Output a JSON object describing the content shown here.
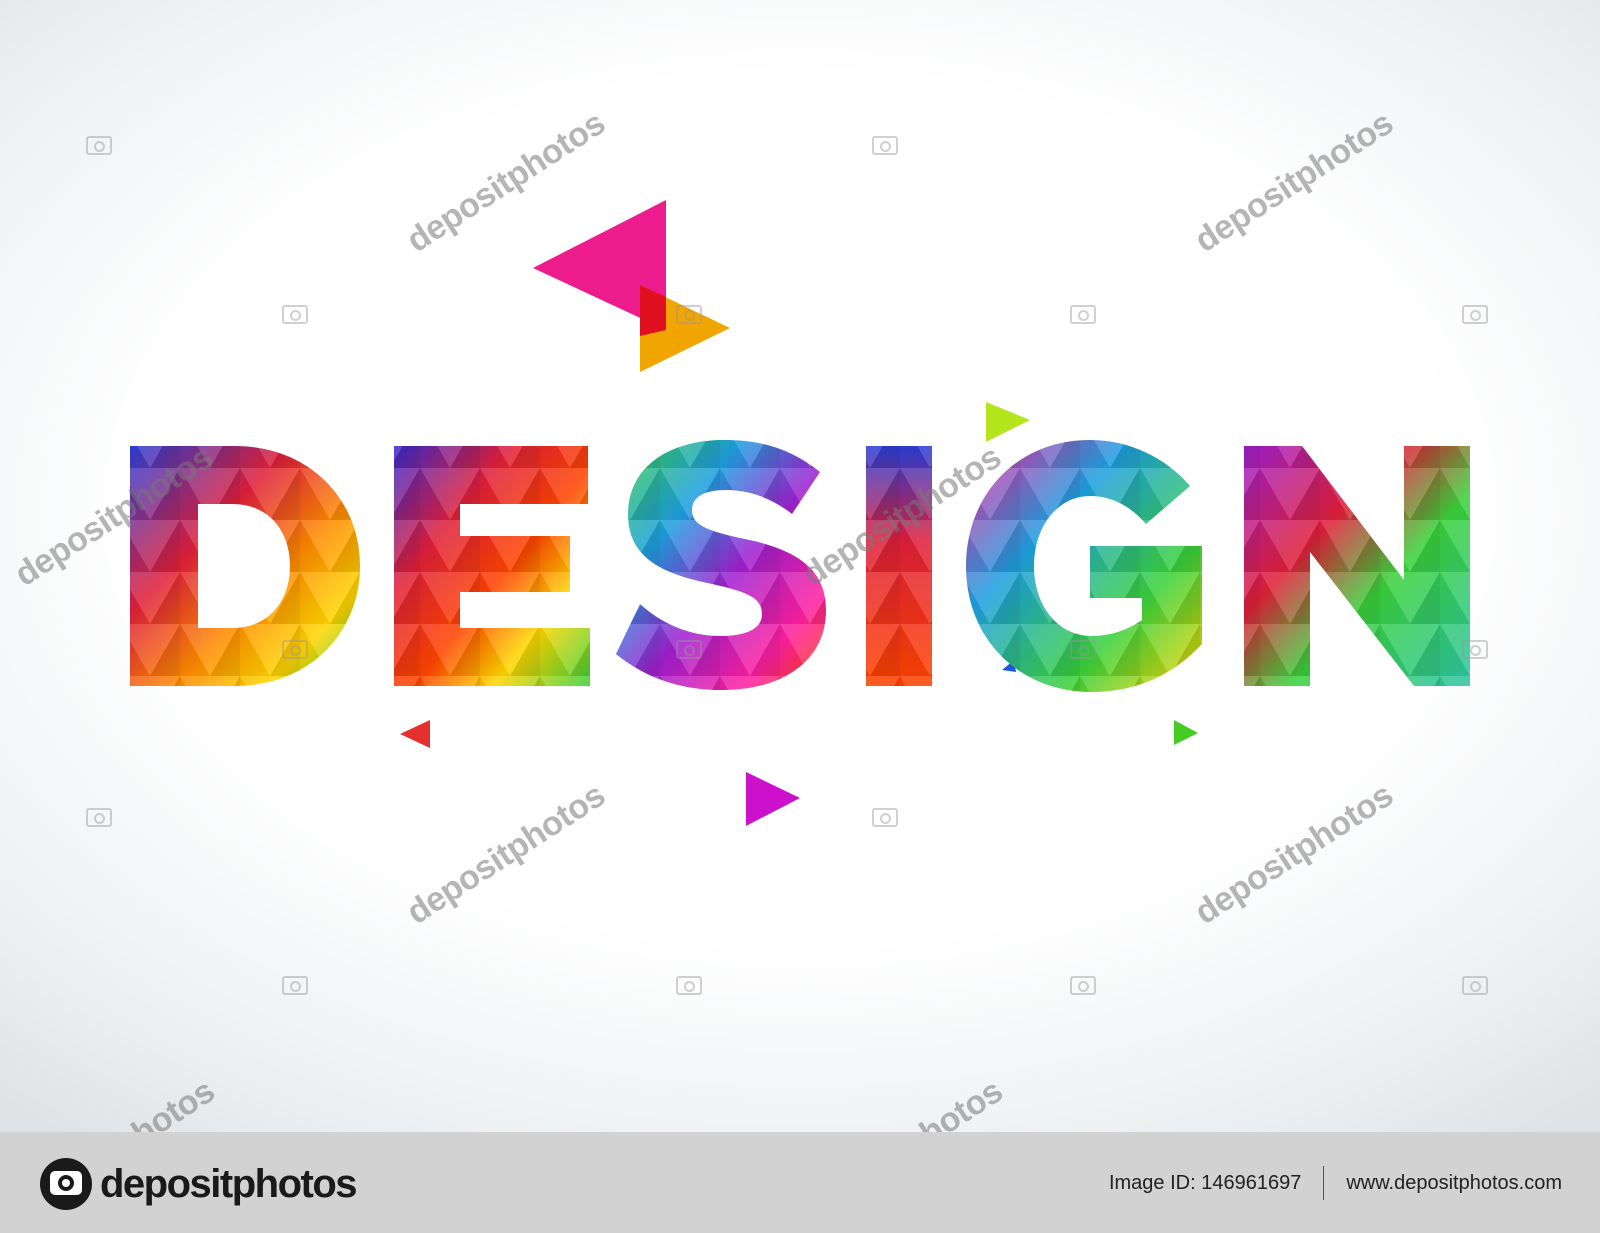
{
  "artwork": {
    "headline": "DESIGN",
    "watermark_text": "depositphotos",
    "watermark_fragment": "photos",
    "watermark_color": "#787878",
    "triangle_colors": [
      "#ec1c8c",
      "#f0a500",
      "#e01020",
      "#e53030",
      "#b5e61d",
      "#44cc22",
      "#cc10cc",
      "#2255dd"
    ],
    "letter_palette": [
      "#2b3fd8",
      "#3a2ad0",
      "#e0203a",
      "#ff4400",
      "#ff8c00",
      "#ffd600",
      "#b8e21b",
      "#3bd13b",
      "#2ec4a6",
      "#1ea0e0",
      "#a020d0",
      "#ff20a0"
    ]
  },
  "footer": {
    "brand_name": "depositphotos",
    "image_id_label": "Image ID: 146961697",
    "site_url": "www.depositphotos.com"
  }
}
